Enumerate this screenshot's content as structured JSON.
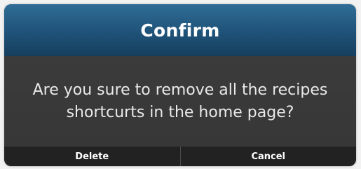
{
  "dialog": {
    "title": "Confirm",
    "message": "Are you sure to remove all the recipes shortcurts in the home page?",
    "buttons": {
      "delete_label": "Delete",
      "cancel_label": "Cancel"
    }
  },
  "colors": {
    "header": "#1f5278",
    "body": "#3a3a3a",
    "footer": "#222222",
    "text": "#ffffff"
  }
}
